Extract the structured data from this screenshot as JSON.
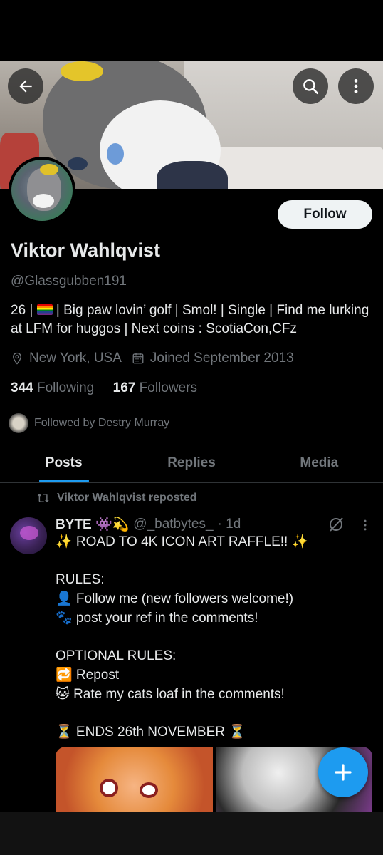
{
  "profile": {
    "name": "Viktor Wahlqvist",
    "handle": "@Glassgubben191",
    "bio_prefix": "26 | ",
    "bio_rest": " | Big paw lovin’ golf | Smol! | Single | Find me lurking at LFM for huggos | Next coins : ScotiaCon,CFz",
    "location": "New York, USA",
    "joined": "Joined September 2013",
    "following_count": "344",
    "following_label": "Following",
    "followers_count": "167",
    "followers_label": "Followers",
    "followed_by": "Followed by Destry Murray"
  },
  "actions": {
    "follow_label": "Follow",
    "back_icon": "arrow-left-icon",
    "search_icon": "search-icon",
    "more_icon": "more-vertical-icon"
  },
  "tabs": [
    {
      "label": "Posts",
      "active": true
    },
    {
      "label": "Replies",
      "active": false
    },
    {
      "label": "Media",
      "active": false
    }
  ],
  "post": {
    "repost_label": "Viktor Wahlqvist reposted",
    "author": "BYTE 👾💫",
    "handle": "@_batbytes_",
    "time": "· 1d",
    "text": "✨ ROAD TO 4K ICON ART RAFFLE!! ✨\n\nRULES:\n👤 Follow me (new followers welcome!)\n🐾 post your ref in the comments!\n\nOPTIONAL RULES:\n🔁 Repost\n🐱 Rate my cats loaf in the comments!\n\n⏳ ENDS 26th NOVEMBER ⏳"
  },
  "colors": {
    "accent": "#1d9bf0",
    "muted": "#71767b",
    "text": "#e7e9ea",
    "background": "#000000"
  }
}
